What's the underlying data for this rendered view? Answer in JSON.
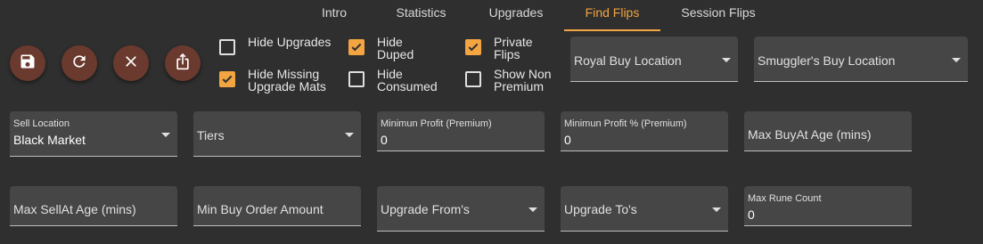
{
  "tabs": [
    {
      "label": "Intro"
    },
    {
      "label": "Statistics"
    },
    {
      "label": "Upgrades"
    },
    {
      "label": "Find Flips"
    },
    {
      "label": "Session Flips"
    }
  ],
  "active_tab": "Find Flips",
  "accent_color": "#f2a541",
  "button_color": "#6b3a2e",
  "action_buttons": [
    {
      "icon": "save-icon"
    },
    {
      "icon": "refresh-icon"
    },
    {
      "icon": "close-icon"
    },
    {
      "icon": "share-icon"
    }
  ],
  "checkboxes": {
    "hide_upgrades": {
      "label": "Hide Upgrades",
      "checked": false
    },
    "hide_missing_upgrade_mats": {
      "label": "Hide Missing Upgrade Mats",
      "checked": true
    },
    "hide_duped": {
      "label": "Hide Duped",
      "checked": true
    },
    "hide_consumed": {
      "label": "Hide Consumed",
      "checked": false
    },
    "private_flips": {
      "label": "Private Flips",
      "checked": true
    },
    "show_non_premium": {
      "label": "Show Non Premium",
      "checked": false
    }
  },
  "fields": {
    "royal_buy_location": {
      "label": "Royal Buy Location"
    },
    "smugglers_buy_location": {
      "label": "Smuggler's Buy Location"
    },
    "sell_location": {
      "label": "Sell Location",
      "value": "Black Market"
    },
    "tiers": {
      "label": "Tiers"
    },
    "minimum_profit_premium": {
      "label": "Minimun Profit (Premium)",
      "value": "0"
    },
    "minimum_profit_pct_premium": {
      "label": "Minimun Profit % (Premium)",
      "value": "0"
    },
    "max_buyat_age": {
      "label": "Max BuyAt Age (mins)"
    },
    "max_sellat_age": {
      "label": "Max SellAt Age (mins)"
    },
    "min_buy_order_amount": {
      "label": "Min Buy Order Amount"
    },
    "upgrade_froms": {
      "label": "Upgrade From's"
    },
    "upgrade_tos": {
      "label": "Upgrade To's"
    },
    "max_rune_count": {
      "label": "Max Rune Count",
      "value": "0"
    }
  }
}
